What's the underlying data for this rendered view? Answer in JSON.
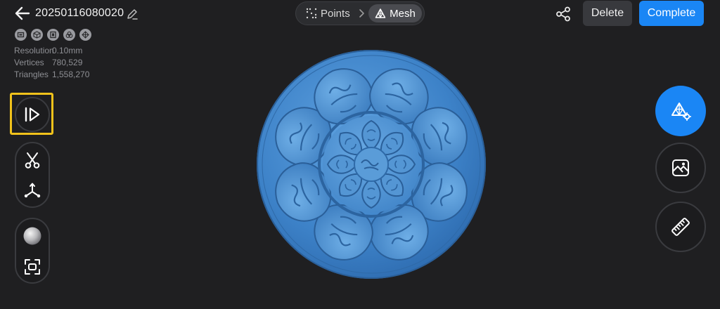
{
  "header": {
    "title": "20250116080020",
    "mode_tabs": [
      {
        "label": "Points",
        "active": false
      },
      {
        "label": "Mesh",
        "active": true
      }
    ],
    "delete_label": "Delete",
    "complete_label": "Complete"
  },
  "info": {
    "view_icons": [
      "front-view-icon",
      "cube-view-icon",
      "side-view-icon",
      "layers-view-icon",
      "axes-view-icon"
    ],
    "stats": [
      {
        "label": "Resolution",
        "value": "0.10mm"
      },
      {
        "label": "Vertices",
        "value": "780,529"
      },
      {
        "label": "Triangles",
        "value": "1,558,270"
      }
    ]
  },
  "left_toolbar": {
    "groups": [
      [
        "play-icon"
      ],
      [
        "scissors-icon",
        "axes-icon"
      ],
      [
        "sphere-shading-icon",
        "fit-view-icon"
      ]
    ],
    "highlighted": "play-icon"
  },
  "right_toolbar": [
    "mesh-settings-icon",
    "texture-image-icon",
    "ruler-icon"
  ],
  "colors": {
    "background": "#1f1f21",
    "accent": "#1a86f5",
    "mesh": "#3e82c8",
    "highlight": "#f1c21b"
  }
}
